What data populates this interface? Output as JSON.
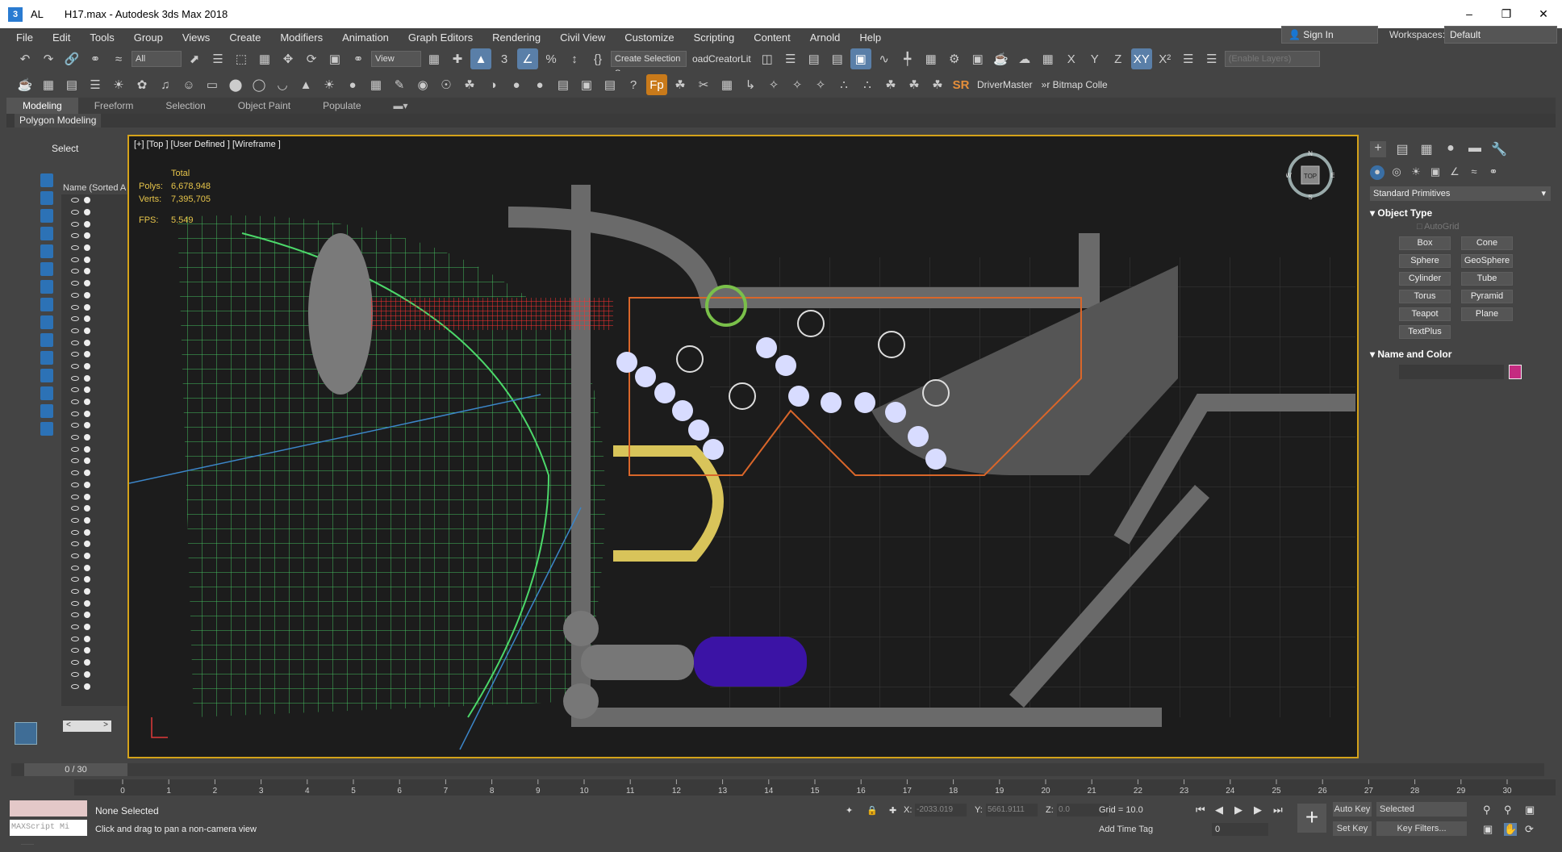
{
  "window": {
    "app_abbr": "AL",
    "title": "H17.max - Autodesk 3ds Max 2018",
    "min": "–",
    "max": "❐",
    "close": "✕"
  },
  "menu": [
    "File",
    "Edit",
    "Tools",
    "Group",
    "Views",
    "Create",
    "Modifiers",
    "Animation",
    "Graph Editors",
    "Rendering",
    "Civil View",
    "Customize",
    "Scripting",
    "Content",
    "Arnold",
    "Help"
  ],
  "account": {
    "sign_in": "Sign In",
    "workspaces_label": "Workspaces:",
    "workspace": "Default"
  },
  "toolbar1": {
    "filter": "All",
    "ref_coord": "View",
    "selection_set": "Create Selection Se",
    "plugin1": "oadCreatorLit",
    "axes": [
      "X",
      "Y",
      "Z",
      "XY",
      "X²"
    ],
    "layers_placeholder": "(Enable Layers)"
  },
  "toolbar2": {
    "plugin_fp": "Fp",
    "plugin_sr": "SR",
    "plugin_driver": "DriverMaster",
    "plugin_bitmap": "»r Bitmap Colle"
  },
  "ribbon": {
    "tabs": [
      "Modeling",
      "Freeform",
      "Selection",
      "Object Paint",
      "Populate"
    ],
    "active_tab": "Modeling",
    "panel": "Polygon Modeling"
  },
  "scene_explorer": {
    "title": "Select",
    "column": "Name (Sorted A"
  },
  "viewport": {
    "label": "[+] [Top ] [User Defined ] [Wireframe ]",
    "stats_title": "Total",
    "polys_label": "Polys:",
    "polys": "6,678,948",
    "verts_label": "Verts:",
    "verts": "7,395,705",
    "fps_label": "FPS:",
    "fps": "5.549",
    "cube": {
      "top": "TOP",
      "n": "N",
      "s": "S",
      "e": "E",
      "w": "W"
    }
  },
  "command_panel": {
    "category": "Standard Primitives",
    "object_type_title": "Object Type",
    "autogrid": "AutoGrid",
    "buttons": [
      "Box",
      "Cone",
      "Sphere",
      "GeoSphere",
      "Cylinder",
      "Tube",
      "Torus",
      "Pyramid",
      "Teapot",
      "Plane",
      "TextPlus"
    ],
    "name_color_title": "Name and Color",
    "object_color": "#c42b80"
  },
  "timeline": {
    "frame": "0 / 30",
    "ticks": [
      "0",
      "1",
      "2",
      "3",
      "4",
      "5",
      "6",
      "7",
      "8",
      "9",
      "10",
      "11",
      "12",
      "13",
      "14",
      "15",
      "16",
      "17",
      "18",
      "19",
      "20",
      "21",
      "22",
      "23",
      "24",
      "25",
      "26",
      "27",
      "28",
      "29",
      "30"
    ]
  },
  "status": {
    "maxscript": "MAXScript Mi",
    "selection": "None Selected",
    "prompt": "Click and drag to pan a non-camera view",
    "x_label": "X:",
    "x": "-2033.019",
    "y_label": "Y:",
    "y": "5661.9111",
    "z_label": "Z:",
    "z": "0.0",
    "grid": "Grid = 10.0",
    "add_time_tag": "Add Time Tag",
    "auto_key": "Auto Key",
    "set_key": "Set Key",
    "key_mode": "Selected",
    "key_filters": "Key Filters...",
    "current_frame": "0"
  }
}
